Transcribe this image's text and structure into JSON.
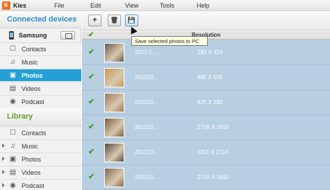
{
  "app": {
    "title": "Kies",
    "logo_letter": "K"
  },
  "menu": [
    "File",
    "Edit",
    "View",
    "Tools",
    "Help"
  ],
  "sidebar": {
    "connected_title": "Connected devices",
    "device_name": "Samsung",
    "device_items": [
      {
        "label": "Contacts",
        "icon": "contacts-icon",
        "selected": false
      },
      {
        "label": "Music",
        "icon": "music-icon",
        "selected": false
      },
      {
        "label": "Photos",
        "icon": "photos-icon",
        "selected": true
      },
      {
        "label": "Videos",
        "icon": "videos-icon",
        "selected": false
      },
      {
        "label": "Podcast",
        "icon": "podcast-icon",
        "selected": false
      }
    ],
    "library_title": "Library",
    "library_items": [
      {
        "label": "Contacts",
        "icon": "contacts-icon"
      },
      {
        "label": "Music",
        "icon": "music-icon"
      },
      {
        "label": "Photos",
        "icon": "photos-icon"
      },
      {
        "label": "Videos",
        "icon": "videos-icon"
      },
      {
        "label": "Podcast",
        "icon": "podcast-icon"
      }
    ]
  },
  "toolbar": {
    "add_label": "+",
    "delete_label": "🗑",
    "save_label": "💾",
    "tooltip": "Save selected photos to PC"
  },
  "table": {
    "header_label": "Resolution",
    "rows": [
      {
        "date": "2012-1...",
        "resolution": "283 X 424",
        "thumb_color": "#6d5a4a"
      },
      {
        "date": "201210...",
        "resolution": "865 X 555",
        "thumb_color": "#c89a52"
      },
      {
        "date": "201210...",
        "resolution": "425 X 282",
        "thumb_color": "#9a7a5a"
      },
      {
        "date": "201210...",
        "resolution": "2716 X 1810",
        "thumb_color": "#7a5e44"
      },
      {
        "date": "201210...",
        "resolution": "1811 X 2714",
        "thumb_color": "#5a4c42"
      },
      {
        "date": "201210...",
        "resolution": "2716 X 1810",
        "thumb_color": "#846850"
      }
    ]
  },
  "colors": {
    "accent": "#24a0d6",
    "section_title": "#2a8fc7",
    "library_title": "#6a9a2a",
    "selection": "#b8cfe2"
  }
}
